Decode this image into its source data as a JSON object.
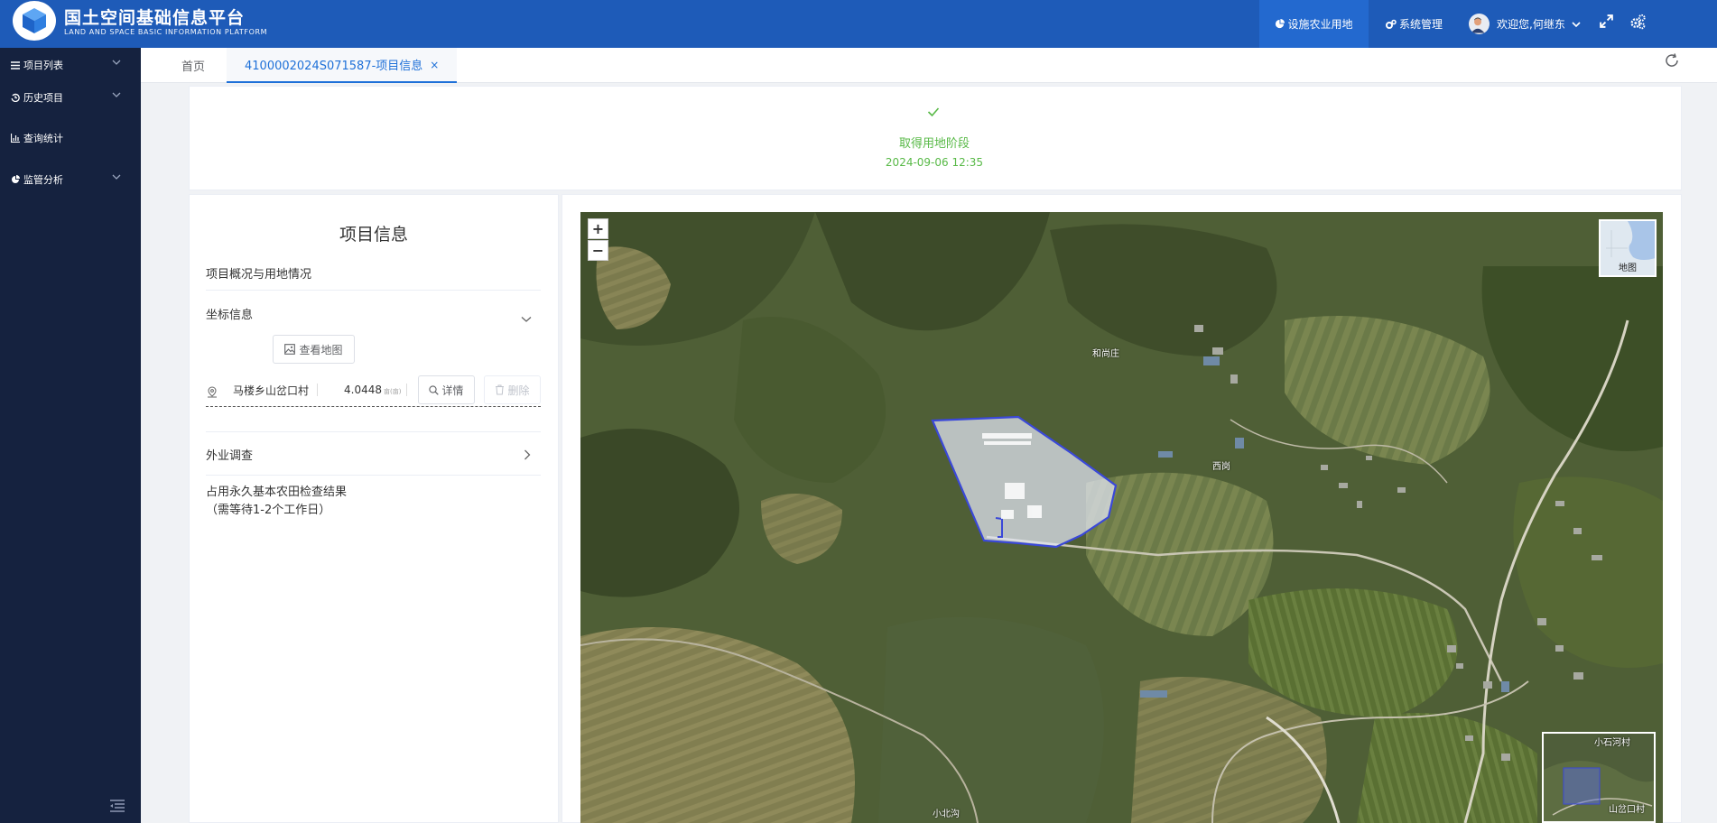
{
  "header": {
    "title": "国土空间基础信息平台",
    "subtitle": "LAND AND SPACE BASIC INFORMATION PLATFORM",
    "nav_active": "设施农业用地",
    "nav_system": "系统管理",
    "welcome": "欢迎您,何继东",
    "icons": [
      "pie-chart-icon",
      "gears-icon",
      "expand-icon",
      "settings-icon"
    ]
  },
  "sidebar": {
    "items": [
      {
        "label": "项目列表",
        "icon": "list-icon",
        "has_submenu": true
      },
      {
        "label": "历史项目",
        "icon": "history-icon",
        "has_submenu": true
      },
      {
        "label": "查询统计",
        "icon": "bar-chart-icon",
        "has_submenu": false
      },
      {
        "label": "监管分析",
        "icon": "pie-chart-icon",
        "has_submenu": true
      }
    ]
  },
  "tabs": {
    "home": "首页",
    "active": "4100002024S071587-项目信息",
    "close": "×"
  },
  "status": {
    "stage": "取得用地阶段",
    "time": "2024-09-06 12:35",
    "color": "#58b947"
  },
  "info": {
    "title": "项目信息",
    "overview": "项目概况与用地情况",
    "coords_section": "坐标信息",
    "view_map": "查看地图",
    "coord_name": "马楼乡山岔口村",
    "coord_area": "4.0448",
    "coord_unit": "亩(亩)",
    "detail": "详情",
    "delete": "删除",
    "field_survey": "外业调查",
    "farmland_check_line1": "占用永久基本农田检查结果",
    "farmland_check_line2": "（需等待1-2个工作日）"
  },
  "map": {
    "zoom_in": "+",
    "zoom_out": "−",
    "layer_label": "地图",
    "place_labels": [
      "和尚庄",
      "西岗",
      "小北沟",
      "小石河村",
      "山岔口村"
    ],
    "parcel_color": "#3a48d8"
  }
}
